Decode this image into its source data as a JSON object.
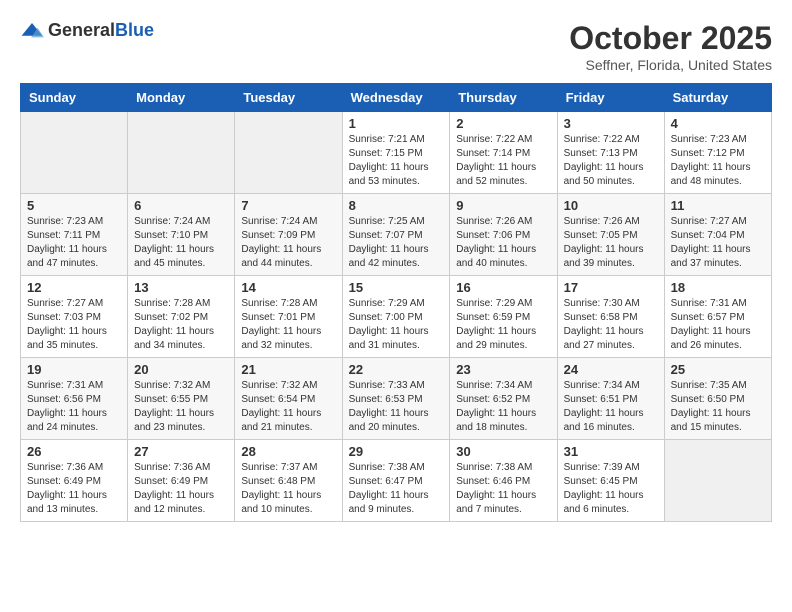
{
  "header": {
    "logo_general": "General",
    "logo_blue": "Blue",
    "month_title": "October 2025",
    "location": "Seffner, Florida, United States"
  },
  "weekdays": [
    "Sunday",
    "Monday",
    "Tuesday",
    "Wednesday",
    "Thursday",
    "Friday",
    "Saturday"
  ],
  "weeks": [
    [
      {
        "day": "",
        "info": ""
      },
      {
        "day": "",
        "info": ""
      },
      {
        "day": "",
        "info": ""
      },
      {
        "day": "1",
        "info": "Sunrise: 7:21 AM\nSunset: 7:15 PM\nDaylight: 11 hours\nand 53 minutes."
      },
      {
        "day": "2",
        "info": "Sunrise: 7:22 AM\nSunset: 7:14 PM\nDaylight: 11 hours\nand 52 minutes."
      },
      {
        "day": "3",
        "info": "Sunrise: 7:22 AM\nSunset: 7:13 PM\nDaylight: 11 hours\nand 50 minutes."
      },
      {
        "day": "4",
        "info": "Sunrise: 7:23 AM\nSunset: 7:12 PM\nDaylight: 11 hours\nand 48 minutes."
      }
    ],
    [
      {
        "day": "5",
        "info": "Sunrise: 7:23 AM\nSunset: 7:11 PM\nDaylight: 11 hours\nand 47 minutes."
      },
      {
        "day": "6",
        "info": "Sunrise: 7:24 AM\nSunset: 7:10 PM\nDaylight: 11 hours\nand 45 minutes."
      },
      {
        "day": "7",
        "info": "Sunrise: 7:24 AM\nSunset: 7:09 PM\nDaylight: 11 hours\nand 44 minutes."
      },
      {
        "day": "8",
        "info": "Sunrise: 7:25 AM\nSunset: 7:07 PM\nDaylight: 11 hours\nand 42 minutes."
      },
      {
        "day": "9",
        "info": "Sunrise: 7:26 AM\nSunset: 7:06 PM\nDaylight: 11 hours\nand 40 minutes."
      },
      {
        "day": "10",
        "info": "Sunrise: 7:26 AM\nSunset: 7:05 PM\nDaylight: 11 hours\nand 39 minutes."
      },
      {
        "day": "11",
        "info": "Sunrise: 7:27 AM\nSunset: 7:04 PM\nDaylight: 11 hours\nand 37 minutes."
      }
    ],
    [
      {
        "day": "12",
        "info": "Sunrise: 7:27 AM\nSunset: 7:03 PM\nDaylight: 11 hours\nand 35 minutes."
      },
      {
        "day": "13",
        "info": "Sunrise: 7:28 AM\nSunset: 7:02 PM\nDaylight: 11 hours\nand 34 minutes."
      },
      {
        "day": "14",
        "info": "Sunrise: 7:28 AM\nSunset: 7:01 PM\nDaylight: 11 hours\nand 32 minutes."
      },
      {
        "day": "15",
        "info": "Sunrise: 7:29 AM\nSunset: 7:00 PM\nDaylight: 11 hours\nand 31 minutes."
      },
      {
        "day": "16",
        "info": "Sunrise: 7:29 AM\nSunset: 6:59 PM\nDaylight: 11 hours\nand 29 minutes."
      },
      {
        "day": "17",
        "info": "Sunrise: 7:30 AM\nSunset: 6:58 PM\nDaylight: 11 hours\nand 27 minutes."
      },
      {
        "day": "18",
        "info": "Sunrise: 7:31 AM\nSunset: 6:57 PM\nDaylight: 11 hours\nand 26 minutes."
      }
    ],
    [
      {
        "day": "19",
        "info": "Sunrise: 7:31 AM\nSunset: 6:56 PM\nDaylight: 11 hours\nand 24 minutes."
      },
      {
        "day": "20",
        "info": "Sunrise: 7:32 AM\nSunset: 6:55 PM\nDaylight: 11 hours\nand 23 minutes."
      },
      {
        "day": "21",
        "info": "Sunrise: 7:32 AM\nSunset: 6:54 PM\nDaylight: 11 hours\nand 21 minutes."
      },
      {
        "day": "22",
        "info": "Sunrise: 7:33 AM\nSunset: 6:53 PM\nDaylight: 11 hours\nand 20 minutes."
      },
      {
        "day": "23",
        "info": "Sunrise: 7:34 AM\nSunset: 6:52 PM\nDaylight: 11 hours\nand 18 minutes."
      },
      {
        "day": "24",
        "info": "Sunrise: 7:34 AM\nSunset: 6:51 PM\nDaylight: 11 hours\nand 16 minutes."
      },
      {
        "day": "25",
        "info": "Sunrise: 7:35 AM\nSunset: 6:50 PM\nDaylight: 11 hours\nand 15 minutes."
      }
    ],
    [
      {
        "day": "26",
        "info": "Sunrise: 7:36 AM\nSunset: 6:49 PM\nDaylight: 11 hours\nand 13 minutes."
      },
      {
        "day": "27",
        "info": "Sunrise: 7:36 AM\nSunset: 6:49 PM\nDaylight: 11 hours\nand 12 minutes."
      },
      {
        "day": "28",
        "info": "Sunrise: 7:37 AM\nSunset: 6:48 PM\nDaylight: 11 hours\nand 10 minutes."
      },
      {
        "day": "29",
        "info": "Sunrise: 7:38 AM\nSunset: 6:47 PM\nDaylight: 11 hours\nand 9 minutes."
      },
      {
        "day": "30",
        "info": "Sunrise: 7:38 AM\nSunset: 6:46 PM\nDaylight: 11 hours\nand 7 minutes."
      },
      {
        "day": "31",
        "info": "Sunrise: 7:39 AM\nSunset: 6:45 PM\nDaylight: 11 hours\nand 6 minutes."
      },
      {
        "day": "",
        "info": ""
      }
    ]
  ]
}
